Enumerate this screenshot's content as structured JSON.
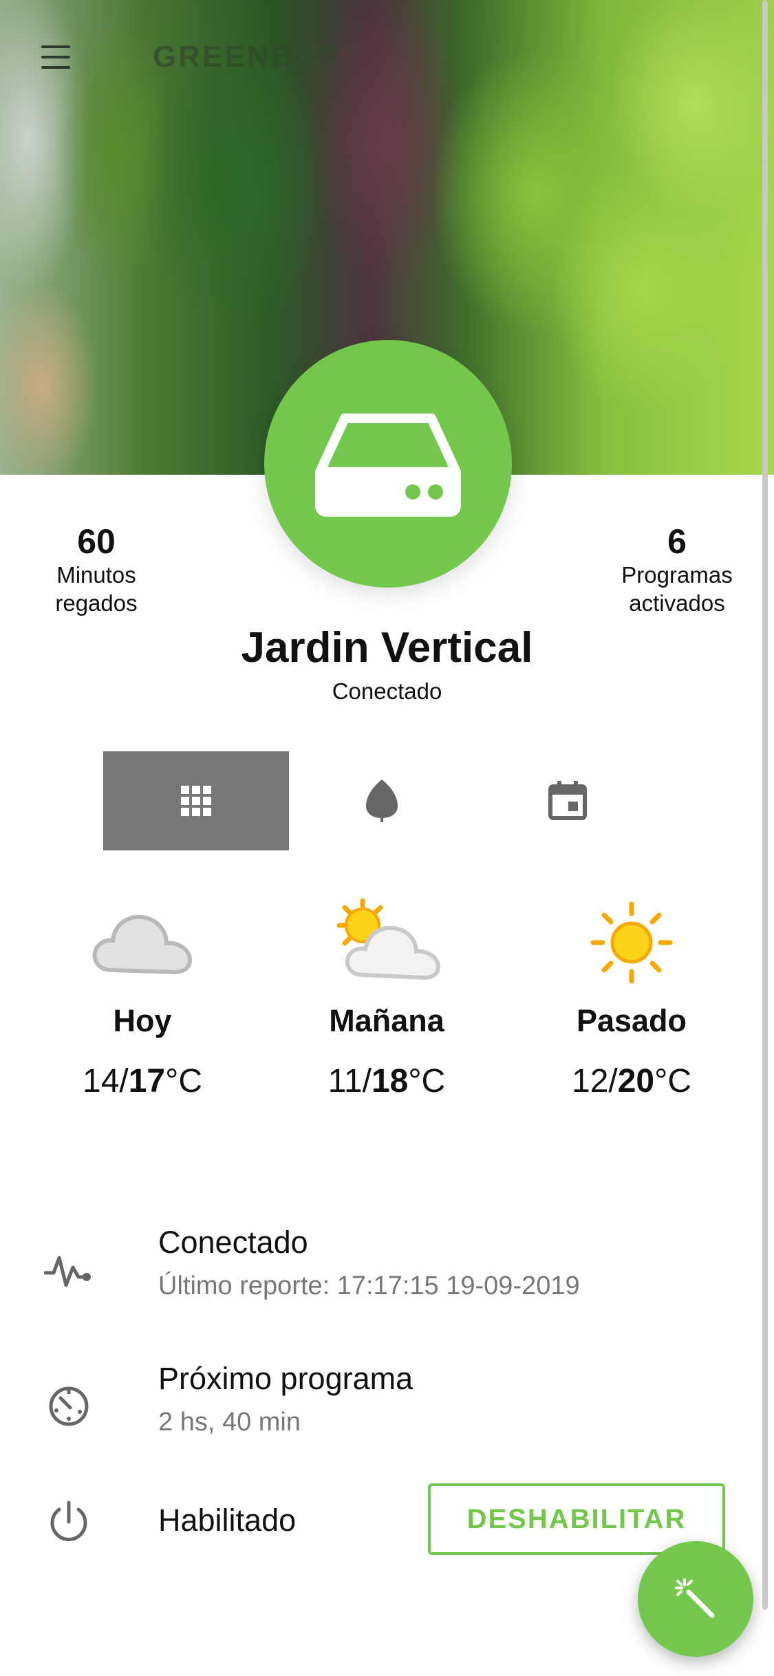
{
  "header": {
    "brand": "GREENBOT"
  },
  "device": {
    "name": "Jardin Vertical",
    "status": "Conectado"
  },
  "stats": {
    "left": {
      "value": "60",
      "label_line1": "Minutos",
      "label_line2": "regados"
    },
    "right": {
      "value": "6",
      "label_line1": "Programas",
      "label_line2": "activados"
    }
  },
  "tabs": [
    {
      "icon": "grid-icon",
      "active": true
    },
    {
      "icon": "leaf-icon",
      "active": false
    },
    {
      "icon": "calendar-icon",
      "active": false
    }
  ],
  "weather": [
    {
      "day": "Hoy",
      "min": "14",
      "max": "17",
      "unit": "°C",
      "icon": "cloud-icon"
    },
    {
      "day": "Mañana",
      "min": "11",
      "max": "18",
      "unit": "°C",
      "icon": "partly-cloudy-icon"
    },
    {
      "day": "Pasado",
      "min": "12",
      "max": "20",
      "unit": "°C",
      "icon": "sun-icon"
    }
  ],
  "connection": {
    "title": "Conectado",
    "subtitle": "Último reporte: 17:17:15 19-09-2019"
  },
  "next_program": {
    "title": "Próximo programa",
    "subtitle": "2 hs, 40 min"
  },
  "enabled": {
    "title": "Habilitado",
    "button": "DESHABILITAR"
  },
  "colors": {
    "accent": "#73c74d",
    "tab_active": "#777777",
    "icon_gray": "#666666",
    "subtitle": "#777777"
  }
}
